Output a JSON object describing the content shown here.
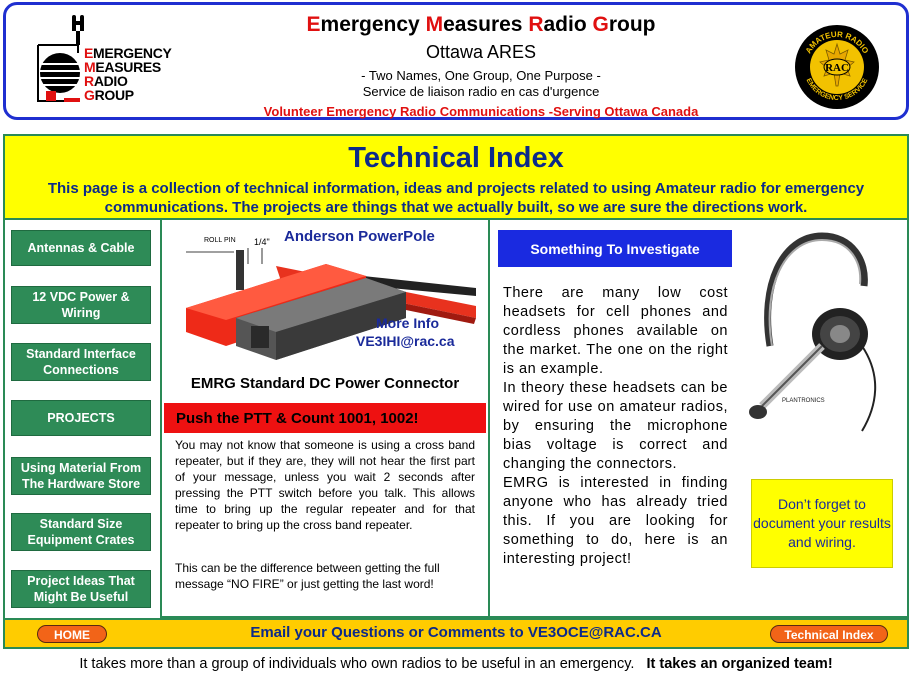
{
  "header": {
    "title_parts": [
      {
        "cap": "E",
        "rest": "mergency "
      },
      {
        "cap": "M",
        "rest": "easures "
      },
      {
        "cap": "R",
        "rest": "adio "
      },
      {
        "cap": "G",
        "rest": "roup"
      }
    ],
    "subtitle": "Ottawa ARES",
    "motto": "- Two Names, One Group, One Purpose -",
    "french": "Service de liaison radio en cas d'urgence",
    "tagline": "Volunteer Emergency Radio Communications -Serving Ottawa Canada",
    "logo_lines": [
      {
        "first": "E",
        "rest": "MERGENCY"
      },
      {
        "first": "M",
        "rest": "EASURES"
      },
      {
        "first": "R",
        "rest": "ADIO"
      },
      {
        "first": "G",
        "rest": "ROUP"
      }
    ],
    "seal": {
      "top_text": "AMATEUR RADIO",
      "center": "RAC",
      "bottom_text": "EMERGENCY SERVICE"
    }
  },
  "index": {
    "title": "Technical Index",
    "description": "This page is a collection of technical information, ideas and projects related to using Amateur radio for emergency communications.  The projects are things that we actually built, so we are sure the directions work."
  },
  "nav": [
    "Antennas & Cable",
    "12 VDC Power & Wiring",
    "Standard Interface Connections",
    "PROJECTS",
    "Using Material From The Hardware Store",
    "Standard Size Equipment Crates",
    "Project Ideas That Might Be Useful"
  ],
  "powerpole": {
    "title": "Anderson PowerPole",
    "roll_pin": "ROLL PIN",
    "quarter": "1/4\"",
    "more_info": "More Info",
    "email": "VE3IHI@rac.ca",
    "caption": "EMRG Standard DC Power Connector"
  },
  "ptt": {
    "heading": "Push the PTT & Count 1001, 1002!",
    "para1": "You may not know that someone is using a cross band repeater, but if they are, they will not hear the first part of your message, unless you wait 2 seconds  after pressing the PTT switch before you talk. This allows time to bring up the regular repeater and for that repeater to bring up the cross band repeater.",
    "para2": "This can be the difference between getting the full message “NO FIRE” or just getting the last word!"
  },
  "investigate": {
    "heading": "Something To Investigate",
    "p1": "There are many low cost headsets for cell phones and cordless phones available on the market. The one on the right is an example.",
    "p2": "In theory these headsets can be wired for use on amateur radios, by ensuring the microphone bias voltage is correct and changing the connectors.",
    "p3": "EMRG is interested in finding anyone who has already tried this. If you are looking for something to do, here is an interesting project!",
    "headset_brand": "PLANTRONICS",
    "reminder": "Don’t forget to document your results and wiring."
  },
  "bottom": {
    "home": "HOME",
    "email_line": "Email your Questions or Comments to VE3OCE@RAC.CA",
    "tech_index": "Technical Index"
  },
  "footer": {
    "normal": "It takes more than  a group of individuals who own radios to  be useful in an emergency.",
    "bold": "It takes an organized team!"
  },
  "colors": {
    "accent_blue": "#1f2fd0",
    "red": "#e01010",
    "yellow": "#ffff00",
    "green": "#2e8b57",
    "orange": "#f26418"
  }
}
